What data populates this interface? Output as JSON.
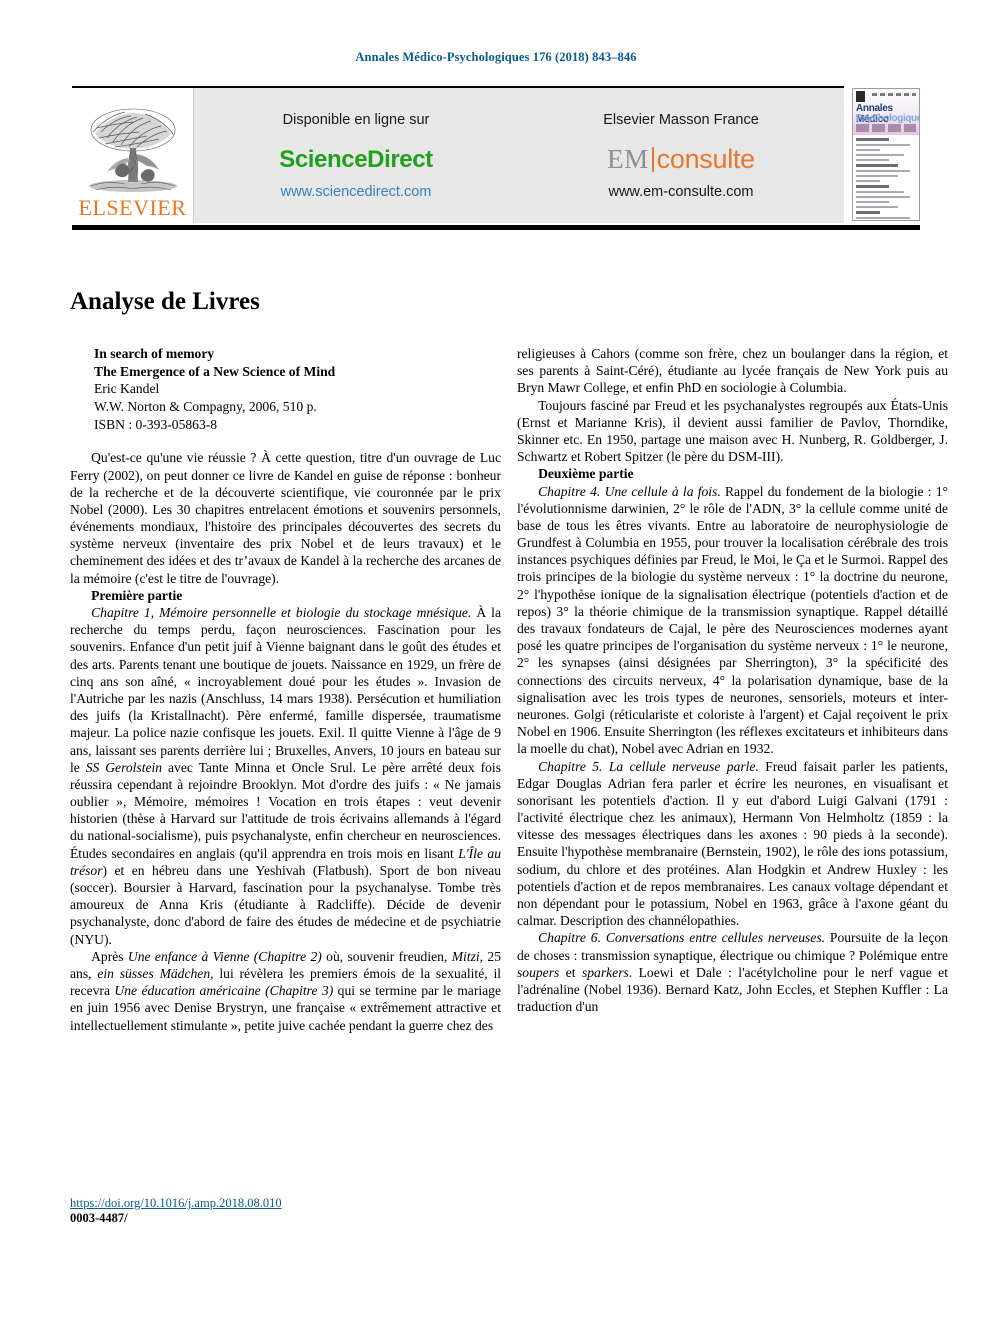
{
  "running_head": "Annales Médico-Psychologiques 176 (2018) 843–846",
  "header": {
    "elsevier_wordmark": "ELSEVIER",
    "sciencedirect": {
      "caption": "Disponible en ligne sur",
      "logo": "ScienceDirect",
      "url": "www.sciencedirect.com"
    },
    "emconsulte": {
      "caption": "Elsevier Masson France",
      "logo_left": "EM",
      "logo_right": "consulte",
      "url": "www.em-consulte.com"
    },
    "cover": {
      "title_line1": "Annales Médico",
      "title_line2": "Psychologiques"
    }
  },
  "article": {
    "title": "Analyse de Livres"
  },
  "book": {
    "title": "In search of memory",
    "subtitle": "The Emergence of a New Science of Mind",
    "author": "Eric Kandel",
    "publisher": "W.W. Norton & Compagny, 2006, 510 p.",
    "isbn": "ISBN : 0-393-05863-8"
  },
  "left_column": {
    "p1": "Qu'est-ce qu'une vie réussie ? À cette question, titre d'un ouvrage de Luc Ferry (2002), on peut donner ce livre de Kandel en guise de réponse : bonheur de la recherche et de la découverte scientifique, vie couronnée par le prix Nobel (2000). Les 30 chapitres entrelacent émotions et souvenirs personnels, événements mondiaux, l'histoire des principales découvertes des secrets du système nerveux (inventaire des prix Nobel et de leurs travaux) et le cheminement des idées et des tr’avaux de Kandel à la recherche des arcanes de la mémoire (c'est le titre de l'ouvrage).",
    "heading_premiere_partie": "Première partie",
    "p2_italic_lead": "Chapitre 1, Mémoire personnelle et biologie du stockage mnésique.",
    "p2_rest": " À la recherche du temps perdu, façon neurosciences. Fascination pour les souvenirs. Enfance d'un petit juif à Vienne baignant dans le goût des études et des arts. Parents tenant une boutique de jouets. Naissance en 1929, un frère de cinq ans son aîné, « incroyablement doué pour les études ». Invasion de l'Autriche par les nazis (Anschluss, 14 mars 1938). Persécution et humiliation des juifs (la Kristallnacht). Père enfermé, famille dispersée, traumatisme majeur. La police nazie confisque les jouets. Exil. Il quitte Vienne à l'âge de 9 ans, laissant ses parents derrière lui ; Bruxelles, Anvers, 10 jours en bateau sur le ",
    "p2_italic_ship": "SS Gerolstein",
    "p2_rest2": " avec Tante Minna et Oncle Srul. Le père arrêté deux fois réussira cependant à rejoindre Brooklyn. Mot d'ordre des juifs : « Ne jamais oublier », Mémoire, mémoires ! Vocation en trois étapes : veut devenir historien (thèse à Harvard sur l'attitude de trois écrivains allemands à l'égard du national-socialisme), puis psychanalyste, enfin chercheur en neurosciences. Études secondaires en anglais (qu'il apprendra en trois mois en lisant ",
    "p2_italic_book": "L'Île au trésor",
    "p2_rest3": ") et en hébreu dans une Yeshivah (Flatbush). Sport de bon niveau (soccer). Boursier à Harvard, fascination pour la psychanalyse. Tombe très amoureux de Anna Kris (étudiante à Radcliffe). Décide de devenir psychanalyste, donc d'abord de faire des études de médecine et de psychiatrie (NYU).",
    "p3_lead": "Après ",
    "p3_italic1": "Une enfance à Vienne (Chapitre 2)",
    "p3_mid1": " où, souvenir freudien, ",
    "p3_italic2": "Mitzi",
    "p3_mid2": ", 25 ans, ",
    "p3_italic3": "ein süsses Mädchen",
    "p3_mid3": ", lui révèlera les premiers émois de la sexualité, il recevra ",
    "p3_italic4": "Une éducation américaine (Chapitre 3)",
    "p3_end": " qui se termine par le mariage en juin 1956 avec Denise Brystryn, une française « extrêmement attractive et intellectuellement stimulante », petite juive cachée pendant la guerre chez des"
  },
  "right_column": {
    "p1": "religieuses à Cahors (comme son frère, chez un boulanger dans la région, et ses parents à Saint-Céré), étudiante au lycée français de New York puis au Bryn Mawr College, et enfin PhD en sociologie à Columbia.",
    "p2": "Toujours fasciné par Freud et les psychanalystes regroupés aux États-Unis (Ernst et Marianne Kris), il devient aussi familier de Pavlov, Thorndike, Skinner etc. En 1950, partage une maison avec H. Nunberg, R. Goldberger, J. Schwartz et Robert Spitzer (le père du DSM-III).",
    "heading_deuxieme_partie": "Deuxième partie",
    "p3_lead": "Chapitre 4. ",
    "p3_italic": "Une cellule à la fois.",
    "p3_rest": " Rappel du fondement de la biologie : 1° l'évolutionnisme darwinien, 2° le rôle de l'ADN, 3° la cellule comme unité de base de tous les êtres vivants. Entre au laboratoire de neurophysiologie de Grundfest à Columbia en 1955, pour trouver la localisation cérébrale des trois instances psychiques définies par Freud, le Moi, le Ça et le Surmoi. Rappel des trois principes de la biologie du système nerveux : 1° la doctrine du neurone, 2° l'hypothèse ionique de la signalisation électrique (potentiels d'action et de repos) 3° la théorie chimique de la transmission synaptique. Rappel détaillé des travaux fondateurs de Cajal, le père des Neurosciences modernes ayant posé les quatre principes de l'organisation du système nerveux : 1° le neurone, 2° les synapses (ainsi désignées par Sherrington), 3° la spécificité des connections des circuits nerveux, 4° la polarisation dynamique, base de la signalisation avec les trois types de neurones, sensoriels, moteurs et inter-neurones. Golgi (réticulariste et coloriste à l'argent) et Cajal reçoivent le prix Nobel en 1906. Ensuite Sherrington (les réflexes excitateurs et inhibiteurs dans la moelle du chat), Nobel avec Adrian en 1932.",
    "p4_lead": "Chapitre 5. ",
    "p4_italic": "La cellule nerveuse parle.",
    "p4_rest": " Freud faisait parler les patients, Edgar Douglas Adrian fera parler et écrire les neurones, en visualisant et sonorisant les potentiels d'action. Il y eut d'abord Luigi Galvani (1791 : l'activité électrique chez les animaux), Hermann Von Helmholtz (1859 : la vitesse des messages électriques dans les axones : 90 pieds à la seconde). Ensuite l'hypothèse membranaire (Bernstein, 1902), le rôle des ions potassium, sodium, du chlore et des protéines. Alan Hodgkin et Andrew Huxley : les potentiels d'action et de repos membranaires. Les canaux voltage dépendant et non dépendant pour le potassium, Nobel en 1963, grâce à l'axone géant du calmar. Description des channélopathies.",
    "p5_lead": "Chapitre 6. ",
    "p5_italic": "Conversations entre cellules nerveuses.",
    "p5_mid": " Poursuite de la leçon de choses : transmission synaptique, électrique ou chimique ? Polémique entre ",
    "p5_italic2": "soupers",
    "p5_mid2": " et ",
    "p5_italic3": "sparkers",
    "p5_end": ". Loewi et Dale : l'acétylcholine pour le nerf vague et l'adrénaline (Nobel 1936). Bernard Katz, John Eccles, et Stephen Kuffler : La traduction d'un"
  },
  "footer": {
    "doi": "https://doi.org/10.1016/j.amp.2018.08.010",
    "issn": "0003-4487/"
  },
  "colors": {
    "running_head": "#0a5b8c",
    "elsevier_orange": "#e87722",
    "sciencedirect_green": "#22a01d",
    "sciencedirect_url_blue": "#3a7fc1",
    "emconsulte_orange": "#e8762c",
    "banner_grey": "#e7e7e7"
  }
}
